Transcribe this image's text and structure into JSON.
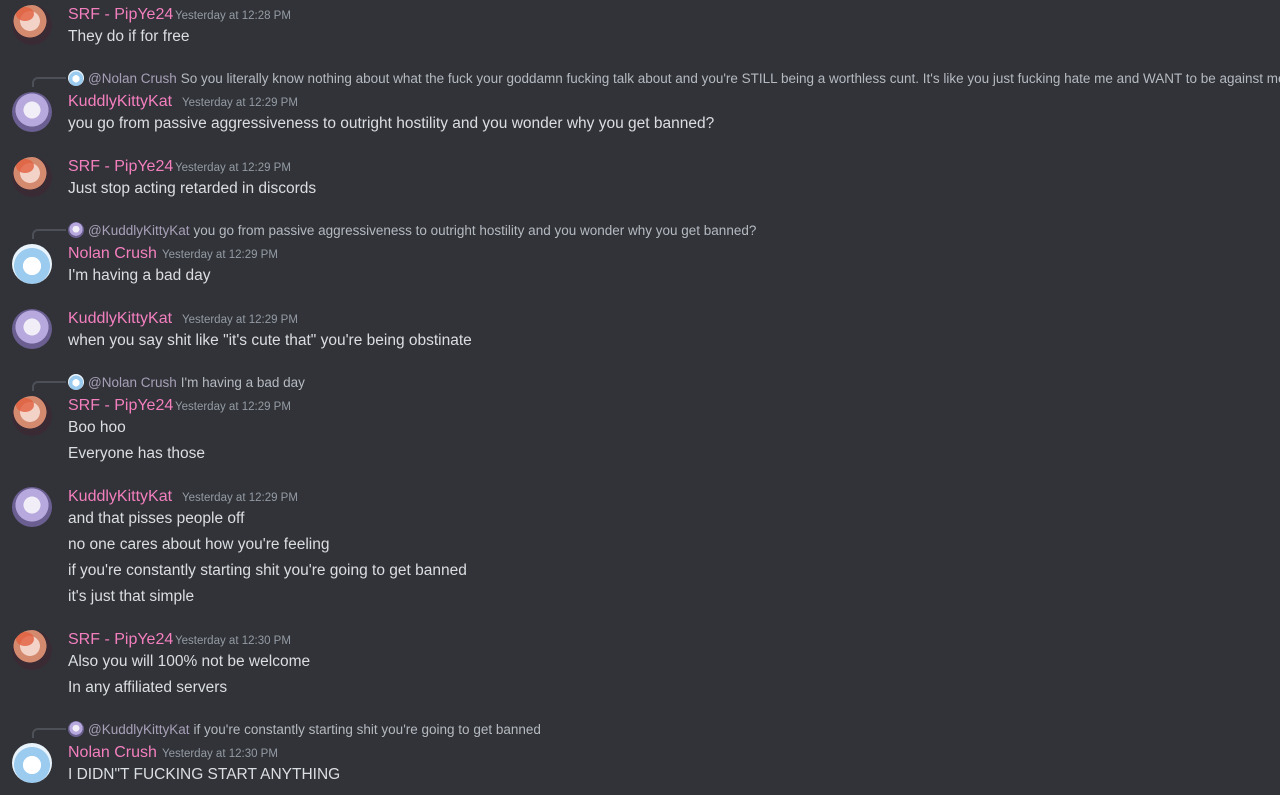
{
  "messages": [
    {
      "author": "SRF - PipYe24",
      "timestamp": "Yesterday at 12:28 PM",
      "lines": [
        "They do if for free"
      ]
    },
    {
      "reply": {
        "to": "@Nolan Crush",
        "text": "So you literally know nothing about what the fuck your goddamn fucking talk about and you're STILL being a worthless cunt. It's like you just fucking hate me and WANT to be against me"
      },
      "author": "KuddlyKittyKat",
      "timestamp": "Yesterday at 12:29 PM",
      "lines": [
        "you go from passive aggressiveness to outright hostility and you wonder why you get banned?"
      ]
    },
    {
      "author": "SRF - PipYe24",
      "timestamp": "Yesterday at 12:29 PM",
      "lines": [
        "Just stop acting retarded in discords"
      ]
    },
    {
      "reply": {
        "to": "@KuddlyKittyKat",
        "text": "you go from passive aggressiveness to outright hostility and you wonder why you get banned?"
      },
      "author": "Nolan Crush",
      "timestamp": "Yesterday at 12:29 PM",
      "lines": [
        "I'm having a bad day"
      ]
    },
    {
      "author": "KuddlyKittyKat",
      "timestamp": "Yesterday at 12:29 PM",
      "lines": [
        "when you say shit like \"it's cute that\" you're being obstinate"
      ]
    },
    {
      "reply": {
        "to": "@Nolan Crush",
        "text": "I'm having a bad day"
      },
      "author": "SRF - PipYe24",
      "timestamp": "Yesterday at 12:29 PM",
      "lines": [
        "Boo hoo",
        "Everyone has those"
      ]
    },
    {
      "author": "KuddlyKittyKat",
      "timestamp": "Yesterday at 12:29 PM",
      "lines": [
        "and that pisses people off",
        "no one cares about how you're feeling",
        "if you're constantly starting shit you're going to get banned",
        "it's just that simple"
      ]
    },
    {
      "author": "SRF - PipYe24",
      "timestamp": "Yesterday at 12:30 PM",
      "lines": [
        "Also you will 100% not be welcome",
        "In any affiliated servers"
      ]
    },
    {
      "reply": {
        "to": "@KuddlyKittyKat",
        "text": "if you're constantly starting shit you're going to get banned"
      },
      "author": "Nolan Crush",
      "timestamp": "Yesterday at 12:30 PM",
      "lines": [
        "I DIDN\"T FUCKING START ANYTHING"
      ]
    }
  ],
  "colors": {
    "background": "#313338",
    "username": "#f47fbf",
    "text": "#dbdee1",
    "timestamp": "#949ba4"
  }
}
